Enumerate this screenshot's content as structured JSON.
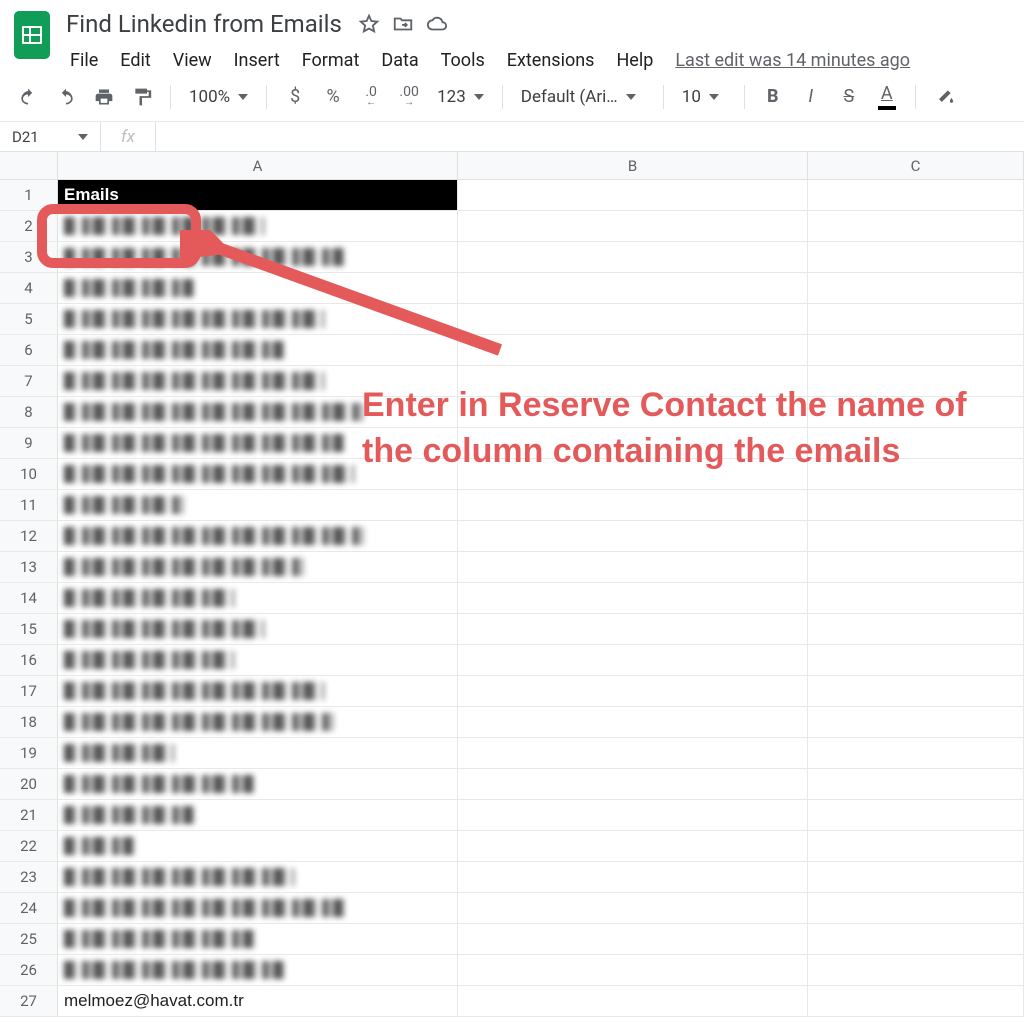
{
  "doc": {
    "title": "Find Linkedin from Emails"
  },
  "menu": {
    "file": "File",
    "edit": "Edit",
    "view": "View",
    "insert": "Insert",
    "format": "Format",
    "data": "Data",
    "tools": "Tools",
    "extensions": "Extensions",
    "help": "Help",
    "last_edit": "Last edit was 14 minutes ago"
  },
  "toolbar": {
    "zoom": "100%",
    "currency": "$",
    "percent": "%",
    "dec_dec": ".0",
    "dec_inc": ".00",
    "more_formats": "123",
    "font": "Default (Ari…",
    "font_size": "10",
    "bold": "B",
    "italic": "I",
    "strike": "S",
    "text_color": "A"
  },
  "namebox": {
    "ref": "D21"
  },
  "fx": {
    "label": "fx"
  },
  "columns": {
    "A": "A",
    "B": "B",
    "C": "C"
  },
  "col_widths": {
    "A": 400,
    "B": 350,
    "C": 216
  },
  "rows": [
    "1",
    "2",
    "3",
    "4",
    "5",
    "6",
    "7",
    "8",
    "9",
    "10",
    "11",
    "12",
    "13",
    "14",
    "15",
    "16",
    "17",
    "18",
    "19",
    "20",
    "21",
    "22",
    "23",
    "24",
    "25",
    "26",
    "27"
  ],
  "cells": {
    "A1": "Emails",
    "A27": "melmoez@havat.com.tr"
  },
  "annotation": {
    "text": "Enter in Reserve Contact the name of the column containing the emails"
  }
}
